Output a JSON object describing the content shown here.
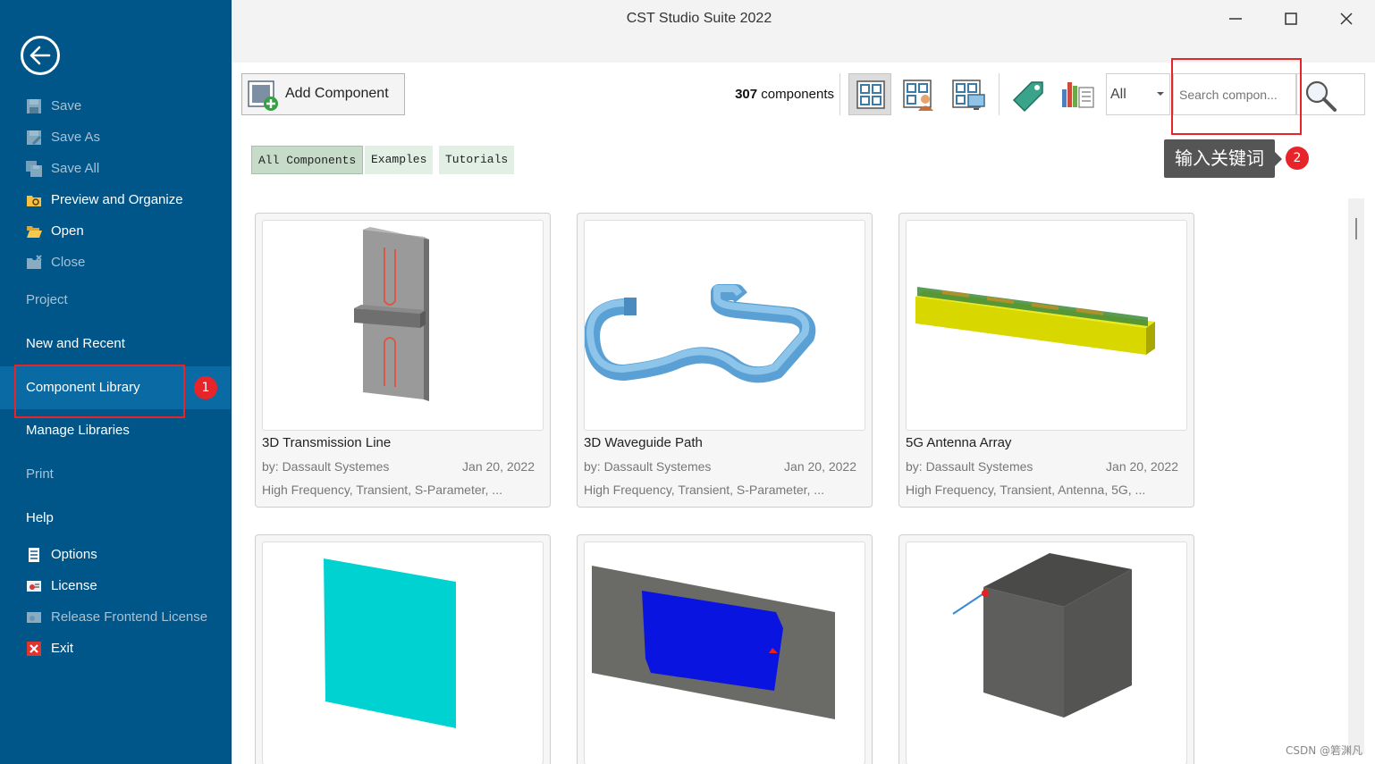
{
  "window": {
    "title": "CST Studio Suite 2022",
    "controls": [
      "minimize-icon",
      "maximize-icon",
      "close-icon"
    ]
  },
  "sidebar": {
    "back_icon": "back-arrow-icon",
    "file_items": [
      {
        "label": "Save",
        "icon": "save-icon",
        "enabled": false
      },
      {
        "label": "Save As",
        "icon": "save-as-icon",
        "enabled": false
      },
      {
        "label": "Save All",
        "icon": "save-all-icon",
        "enabled": false
      },
      {
        "label": "Preview and Organize",
        "icon": "preview-organize-icon",
        "enabled": true
      },
      {
        "label": "Open",
        "icon": "folder-open-icon",
        "enabled": true
      },
      {
        "label": "Close",
        "icon": "close-folder-icon",
        "enabled": false
      }
    ],
    "sections": [
      {
        "label": "Project",
        "enabled": false
      },
      {
        "label": "New and Recent",
        "enabled": true
      },
      {
        "label": "Component Library",
        "enabled": true,
        "active": true
      },
      {
        "label": "Manage Libraries",
        "enabled": true
      },
      {
        "label": "Print",
        "enabled": false
      },
      {
        "label": "Help",
        "enabled": true
      }
    ],
    "bottom_items": [
      {
        "label": "Options",
        "icon": "options-icon",
        "enabled": true
      },
      {
        "label": "License",
        "icon": "license-icon",
        "enabled": true
      },
      {
        "label": "Release Frontend License",
        "icon": "release-license-icon",
        "enabled": false
      },
      {
        "label": "Exit",
        "icon": "exit-icon",
        "enabled": true
      }
    ]
  },
  "toolbar": {
    "add_component_label": "Add Component",
    "count_value": "307",
    "count_suffix": " components",
    "view_icons": [
      "grid-view-icon",
      "author-view-icon",
      "screen-view-icon"
    ],
    "tag_icon": "tag-icon",
    "chart_icon": "chart-list-icon",
    "filter_value": "All",
    "search_placeholder": "Search compon...",
    "search_icon": "magnifier-icon"
  },
  "annotations": {
    "badge_1": "1",
    "badge_2": "2",
    "tooltip": "输入关键词",
    "accent": "#e8242b"
  },
  "categories": [
    "All Components",
    "Examples",
    "Tutorials"
  ],
  "components": [
    {
      "name": "3D Transmission Line",
      "author": "by: Dassault Systemes",
      "date": "Jan 20, 2022",
      "tags": "High Frequency, Transient, S-Parameter, ..."
    },
    {
      "name": "3D Waveguide Path",
      "author": "by: Dassault Systemes",
      "date": "Jan 20, 2022",
      "tags": "High Frequency, Transient, S-Parameter, ..."
    },
    {
      "name": "5G Antenna Array",
      "author": "by: Dassault Systemes",
      "date": "Jan 20, 2022",
      "tags": "High Frequency, Transient, Antenna, 5G, ..."
    }
  ],
  "footer": {
    "watermark": "CSDN @箬渊凡"
  }
}
